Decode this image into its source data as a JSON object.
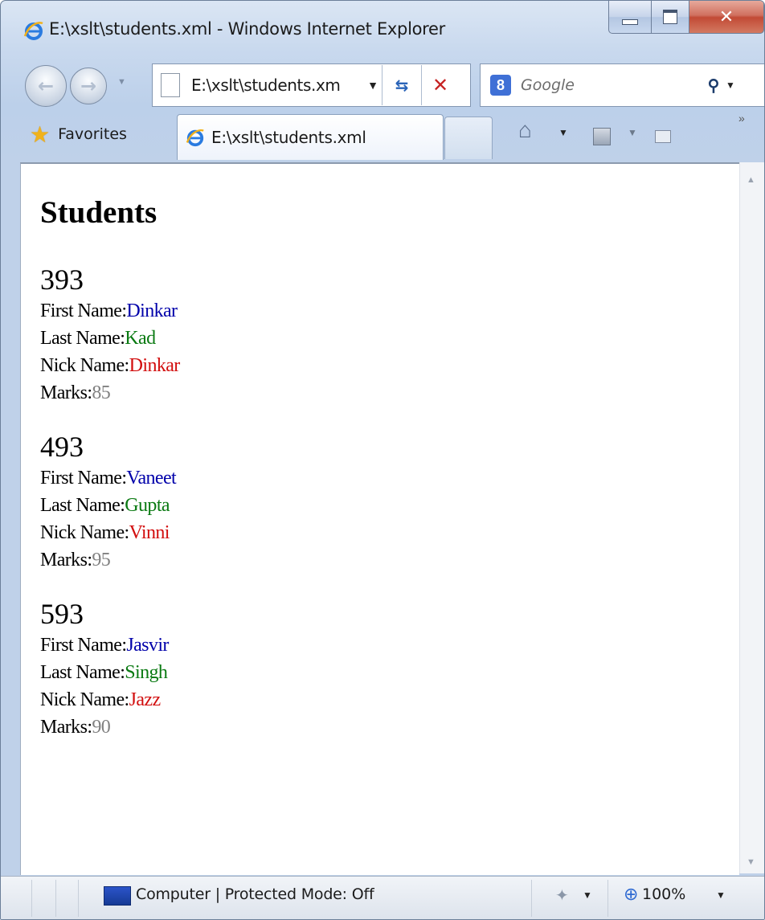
{
  "window": {
    "title": "E:\\xslt\\students.xml - Windows Internet Explorer",
    "accent_close": "#c24a35"
  },
  "navigation": {
    "back_arrow": "←",
    "forward_arrow": "→",
    "address": "E:\\xslt\\students.xm",
    "search_provider_glyph": "8",
    "search_placeholder": "Google"
  },
  "favorites": {
    "label": "Favorites",
    "active_tab": "E:\\xslt\\students.xml"
  },
  "page": {
    "heading": "Students",
    "labels": {
      "first_name": "First Name:",
      "last_name": "Last Name:",
      "nick_name": "Nick Name:",
      "marks": "Marks:"
    },
    "students": [
      {
        "id": "393",
        "first_name": "Dinkar",
        "last_name": "Kad",
        "nick_name": "Dinkar",
        "marks": "85"
      },
      {
        "id": "493",
        "first_name": "Vaneet",
        "last_name": "Gupta",
        "nick_name": "Vinni",
        "marks": "95"
      },
      {
        "id": "593",
        "first_name": "Jasvir",
        "last_name": "Singh",
        "nick_name": "Jazz",
        "marks": "90"
      }
    ],
    "colors": {
      "first_name": "#0000aa",
      "last_name": "#0a7a12",
      "nick_name": "#d20e0e",
      "marks": "#808080"
    }
  },
  "status": {
    "zone_text": "Computer | Protected Mode: Off",
    "zoom": "100%"
  }
}
